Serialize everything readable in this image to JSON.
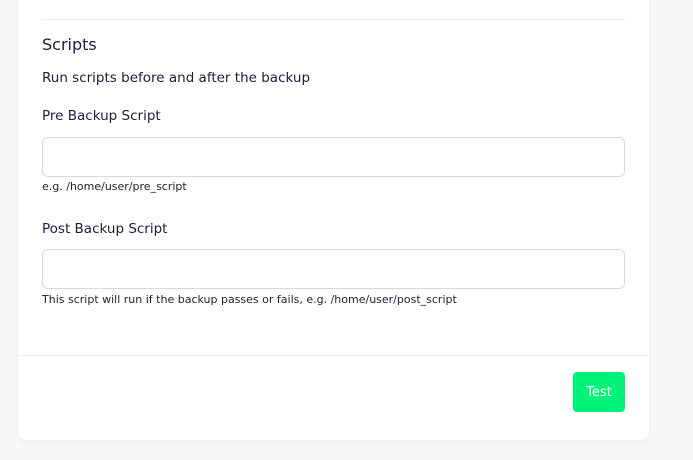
{
  "scripts_section": {
    "title": "Scripts",
    "description": "Run scripts before and after the backup"
  },
  "pre_backup": {
    "label": "Pre Backup Script",
    "value": "",
    "help": "e.g. /home/user/pre_script"
  },
  "post_backup": {
    "label": "Post Backup Script",
    "value": "",
    "help": "This script will run if the backup passes or fails, e.g. /home/user/post_script"
  },
  "footer": {
    "test_label": "Test"
  },
  "colors": {
    "accent": "#00f27b",
    "text": "#1f1d3d",
    "border": "#d9d8e6"
  }
}
